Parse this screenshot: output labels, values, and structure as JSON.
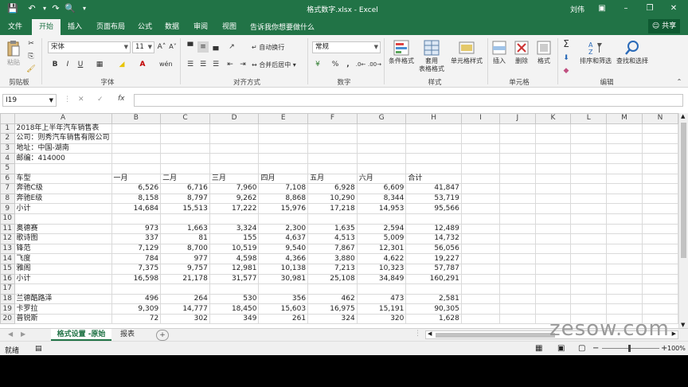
{
  "titlebar": {
    "doc_title": "格式数字.xlsx  -  Excel",
    "user": "刘伟",
    "save_icon": "save-icon",
    "undo_icon": "undo-icon",
    "redo_icon": "redo-icon"
  },
  "tabs": [
    "文件",
    "开始",
    "插入",
    "页面布局",
    "公式",
    "数据",
    "审阅",
    "视图"
  ],
  "active_tab": "开始",
  "tell_me": "告诉我你想要做什么",
  "share": "共享",
  "ribbon": {
    "clipboard": {
      "paste": "粘贴",
      "label": "剪贴板"
    },
    "font": {
      "name": "宋体",
      "size": "11",
      "label": "字体"
    },
    "alignment": {
      "wrap": "自动换行",
      "merge": "合并后居中",
      "label": "对齐方式"
    },
    "number": {
      "format": "常规",
      "label": "数字"
    },
    "styles": {
      "conditional": "条件格式",
      "table": "套用",
      "table2": "表格格式",
      "cell_styles": "单元格样式",
      "label": "样式"
    },
    "cells": {
      "insert": "插入",
      "delete": "删除",
      "format": "格式",
      "label": "单元格"
    },
    "editing": {
      "sort": "排序和筛选",
      "find": "查找和选择",
      "label": "编辑"
    }
  },
  "formula_bar": {
    "name_box": "I19",
    "fx": "fx",
    "cancel": "✕",
    "enter": "✓",
    "value": ""
  },
  "columns": [
    "A",
    "B",
    "C",
    "D",
    "E",
    "F",
    "G",
    "H",
    "I",
    "J",
    "K",
    "L",
    "M",
    "N"
  ],
  "rows": [
    {
      "n": "1",
      "cells": [
        "2018年上半年汽车销售表",
        "",
        "",
        "",
        "",
        "",
        "",
        ""
      ]
    },
    {
      "n": "2",
      "cells": [
        "公司：则秀汽车销售有限公司",
        "",
        "",
        "",
        "",
        "",
        "",
        ""
      ]
    },
    {
      "n": "3",
      "cells": [
        "地址：中国-湖南",
        "",
        "",
        "",
        "",
        "",
        "",
        ""
      ]
    },
    {
      "n": "4",
      "cells": [
        "邮编：414000",
        "",
        "",
        "",
        "",
        "",
        "",
        ""
      ]
    },
    {
      "n": "5",
      "cells": [
        "",
        "",
        "",
        "",
        "",
        "",
        "",
        ""
      ]
    },
    {
      "n": "6",
      "cells": [
        "车型",
        "一月",
        "二月",
        "三月",
        "四月",
        "五月",
        "六月",
        "合计"
      ]
    },
    {
      "n": "7",
      "cells": [
        "奔驰C级",
        "6,526",
        "6,716",
        "7,960",
        "7,108",
        "6,928",
        "6,609",
        "41,847"
      ]
    },
    {
      "n": "8",
      "cells": [
        "奔驰E级",
        "8,158",
        "8,797",
        "9,262",
        "8,868",
        "10,290",
        "8,344",
        "53,719"
      ]
    },
    {
      "n": "9",
      "cells": [
        "小计",
        "14,684",
        "15,513",
        "17,222",
        "15,976",
        "17,218",
        "14,953",
        "95,566"
      ]
    },
    {
      "n": "10",
      "cells": [
        "",
        "",
        "",
        "",
        "",
        "",
        "",
        ""
      ]
    },
    {
      "n": "11",
      "cells": [
        "奥德赛",
        "973",
        "1,663",
        "3,324",
        "2,300",
        "1,635",
        "2,594",
        "12,489"
      ]
    },
    {
      "n": "12",
      "cells": [
        "歌诗图",
        "337",
        "81",
        "155",
        "4,637",
        "4,513",
        "5,009",
        "14,732"
      ]
    },
    {
      "n": "13",
      "cells": [
        "锋范",
        "7,129",
        "8,700",
        "10,519",
        "9,540",
        "7,867",
        "12,301",
        "56,056"
      ]
    },
    {
      "n": "14",
      "cells": [
        "飞度",
        "784",
        "977",
        "4,598",
        "4,366",
        "3,880",
        "4,622",
        "19,227"
      ]
    },
    {
      "n": "15",
      "cells": [
        "雅阁",
        "7,375",
        "9,757",
        "12,981",
        "10,138",
        "7,213",
        "10,323",
        "57,787"
      ]
    },
    {
      "n": "16",
      "cells": [
        "小计",
        "16,598",
        "21,178",
        "31,577",
        "30,981",
        "25,108",
        "34,849",
        "160,291"
      ]
    },
    {
      "n": "17",
      "cells": [
        "",
        "",
        "",
        "",
        "",
        "",
        "",
        ""
      ]
    },
    {
      "n": "18",
      "cells": [
        "兰德酷路泽",
        "496",
        "264",
        "530",
        "356",
        "462",
        "473",
        "2,581"
      ]
    },
    {
      "n": "19",
      "cells": [
        "卡罗拉",
        "9,309",
        "14,777",
        "18,450",
        "15,603",
        "16,975",
        "15,191",
        "90,305"
      ]
    },
    {
      "n": "20",
      "cells": [
        "普锐斯",
        "72",
        "302",
        "349",
        "261",
        "324",
        "320",
        "1,628"
      ]
    }
  ],
  "sheet_tabs": [
    "格式设置 -原始",
    "报表"
  ],
  "active_sheet": "格式设置 -原始",
  "status": {
    "ready": "就绪",
    "zoom": "100%"
  },
  "watermark": "zesow.com",
  "colors": {
    "accent": "#217346",
    "sheet_active": "#217346"
  }
}
